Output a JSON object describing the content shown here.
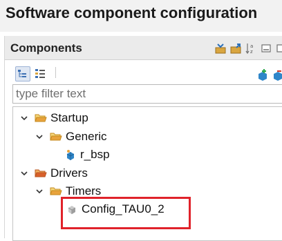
{
  "header": {
    "title": "Software component configuration"
  },
  "panel": {
    "title": "Components",
    "header_icons": [
      "collapse-all-icon",
      "expand-icon",
      "sort-az-icon",
      "minimize-icon",
      "maximize-icon"
    ],
    "toolbar_icons": [
      "tree-view-icon",
      "flat-view-icon",
      "add-component-icon",
      "remove-component-icon"
    ]
  },
  "filter": {
    "value": "",
    "placeholder": "type filter text"
  },
  "tree": {
    "startup": "Startup",
    "generic": "Generic",
    "r_bsp": "r_bsp",
    "drivers": "Drivers",
    "timers": "Timers",
    "config": "Config_TAU0_2"
  },
  "colors": {
    "highlight": "#e0222a",
    "folder": "#e8a33c",
    "folder_drivers": "#d9602b",
    "bsp": "#2f86c9"
  }
}
